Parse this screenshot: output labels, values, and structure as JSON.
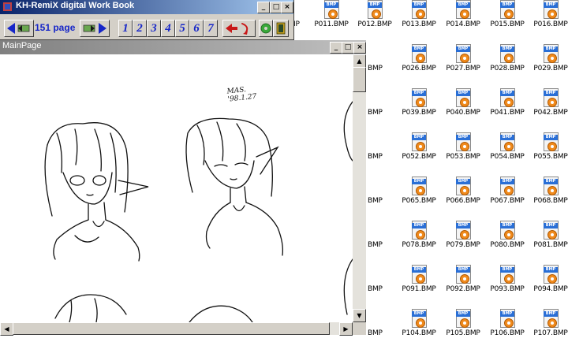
{
  "toolbar_window": {
    "title": "KH-RemiX digital Work Book",
    "page_label": "151 page",
    "number_buttons": [
      "1",
      "2",
      "3",
      "4",
      "5",
      "6",
      "7"
    ]
  },
  "main_window": {
    "title": "MainPage",
    "signature": "MAS. '98.1.27"
  },
  "desktop_icons": [
    {
      "label": "P011.BMP"
    },
    {
      "label": "P012.BMP"
    },
    {
      "label": "P013.BMP"
    },
    {
      "label": "P014.BMP"
    },
    {
      "label": "P015.BMP"
    },
    {
      "label": "P016.BMP"
    },
    {
      "label": "P026.BMP"
    },
    {
      "label": "P027.BMP"
    },
    {
      "label": "P028.BMP"
    },
    {
      "label": "P029.BMP"
    },
    {
      "label": "P039.BMP"
    },
    {
      "label": "P040.BMP"
    },
    {
      "label": "P041.BMP"
    },
    {
      "label": "P042.BMP"
    },
    {
      "label": "P052.BMP"
    },
    {
      "label": "P053.BMP"
    },
    {
      "label": "P054.BMP"
    },
    {
      "label": "P055.BMP"
    },
    {
      "label": "P065.BMP"
    },
    {
      "label": "P066.BMP"
    },
    {
      "label": "P067.BMP"
    },
    {
      "label": "P068.BMP"
    },
    {
      "label": "P078.BMP"
    },
    {
      "label": "P079.BMP"
    },
    {
      "label": "P080.BMP"
    },
    {
      "label": "P081.BMP"
    },
    {
      "label": "P091.BMP"
    },
    {
      "label": "P092.BMP"
    },
    {
      "label": "P093.BMP"
    },
    {
      "label": "P094.BMP"
    },
    {
      "label": "P104.BMP"
    },
    {
      "label": "P105.BMP"
    },
    {
      "label": "P106.BMP"
    },
    {
      "label": "P107.BMP"
    }
  ],
  "partial_icon_labels": [
    "IP",
    "BMP",
    "BMP",
    "BMP",
    "BMP",
    "BMP",
    "BMP",
    "BMP"
  ],
  "colors": {
    "accent": "#1626c8",
    "titlebar": "#0a246a",
    "icon_band": "#2a6fd6",
    "icon_gear": "#f08a1c"
  }
}
